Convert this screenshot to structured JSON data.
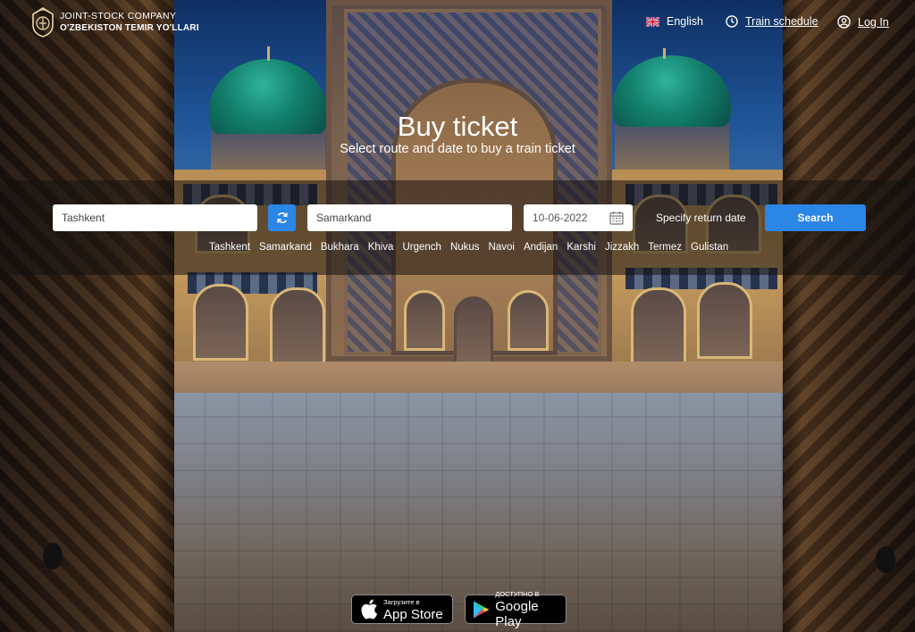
{
  "header": {
    "logo_line1": "JOINT-STOCK COMPANY",
    "logo_line2": "O'ZBEKISTON TEMIR YO'LLARI",
    "language": "English",
    "train_schedule": "Train schedule",
    "login": "Log In"
  },
  "hero": {
    "title": "Buy ticket",
    "subtitle": "Select route and date to buy a train ticket"
  },
  "search": {
    "from_value": "Tashkent",
    "to_value": "Samarkand",
    "date_value": "10-06-2022",
    "return_label": "Specify return date",
    "button_label": "Search",
    "cities": [
      "Tashkent",
      "Samarkand",
      "Bukhara",
      "Khiva",
      "Urgench",
      "Nukus",
      "Navoi",
      "Andijan",
      "Karshi",
      "Jizzakh",
      "Termez",
      "Gulistan"
    ]
  },
  "stores": {
    "appstore_small": "Загрузите в",
    "appstore_big": "App Store",
    "googleplay_small": "ДОСТУПНО В",
    "googleplay_big": "Google Play"
  },
  "colors": {
    "accent": "#2b86e6"
  }
}
